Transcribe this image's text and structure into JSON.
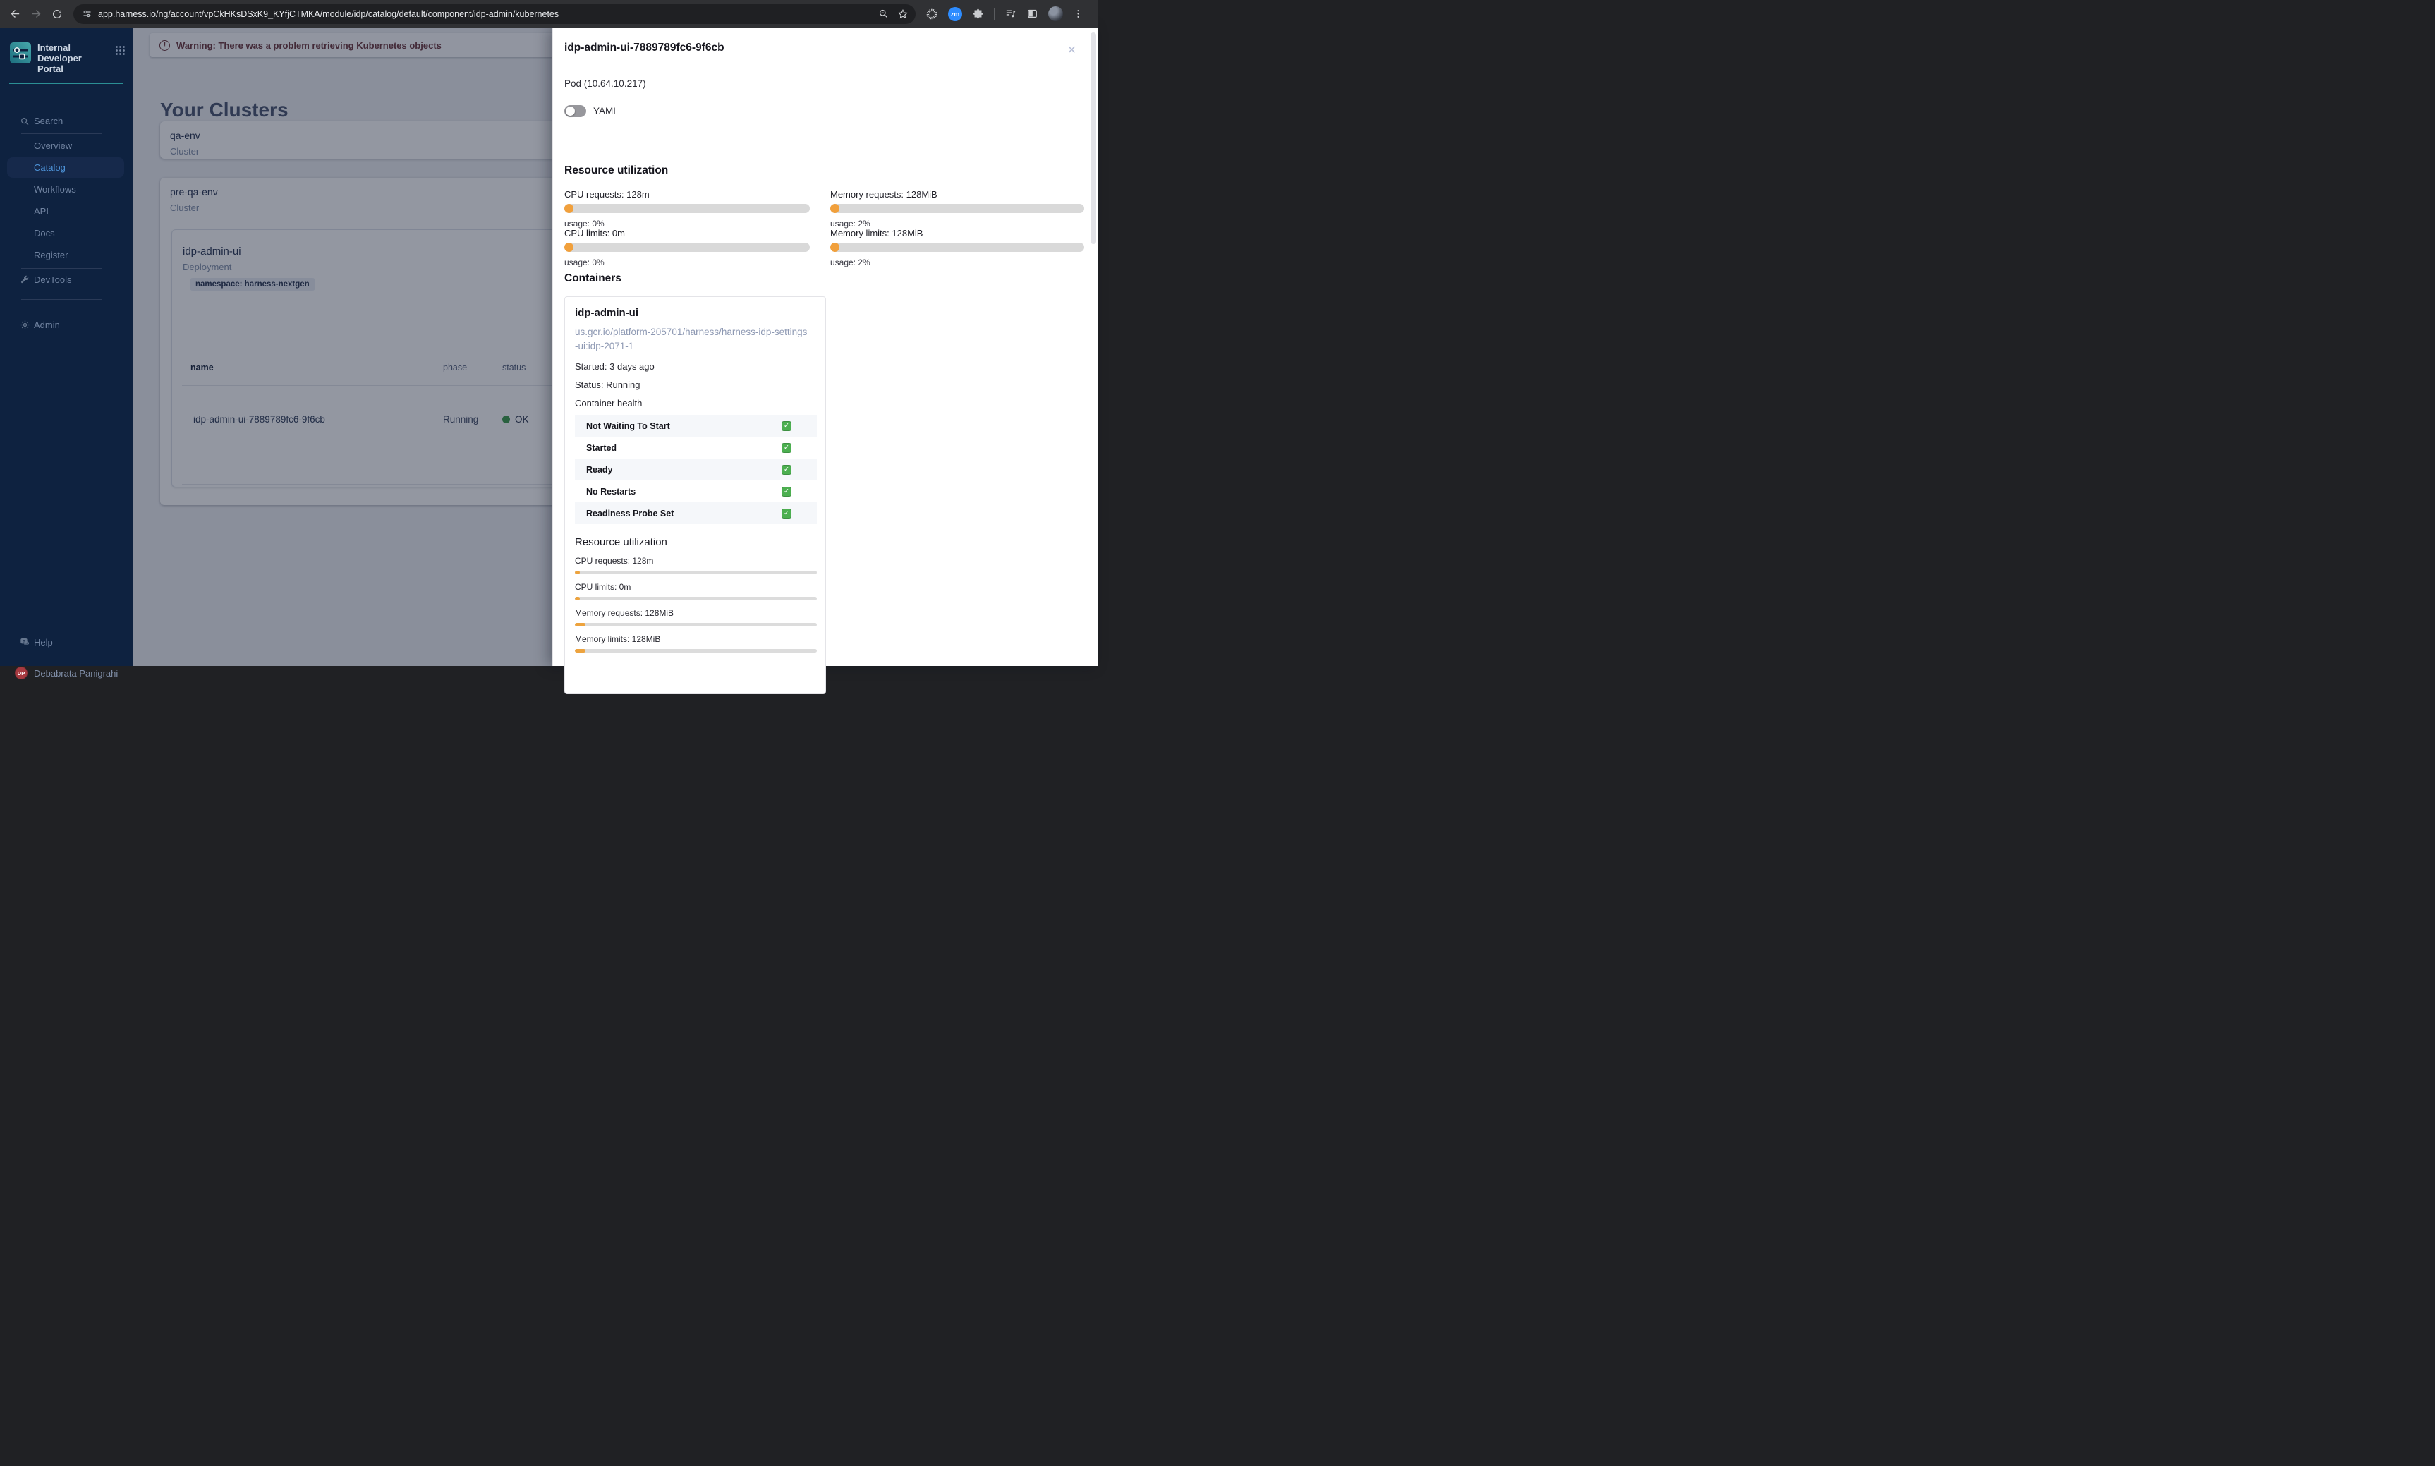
{
  "browser": {
    "url": "app.harness.io/ng/account/vpCkHKsDSxK9_KYfjCTMKA/module/idp/catalog/default/component/idp-admin/kubernetes",
    "zm_badge": "zm"
  },
  "icons": {
    "close": "✕",
    "warning": "!",
    "check": "✓"
  },
  "colors": {
    "accent_orange": "#F1A03C",
    "success_green": "#3F9D4E",
    "sidebar_active_blue": "#4D93D8",
    "sidebar_bg": "#0E2240",
    "warning_text": "#6D3A41"
  },
  "sidebar": {
    "title": "Internal Developer Portal",
    "search_label": "Search",
    "items": [
      {
        "label": "Overview",
        "active": false
      },
      {
        "label": "Catalog",
        "active": true
      },
      {
        "label": "Workflows",
        "active": false
      },
      {
        "label": "API",
        "active": false
      },
      {
        "label": "Docs",
        "active": false
      },
      {
        "label": "Register",
        "active": false
      }
    ],
    "devtools_label": "DevTools",
    "admin_label": "Admin",
    "help_label": "Help",
    "user": {
      "initials": "DP",
      "name": "Debabrata Panigrahi"
    }
  },
  "main": {
    "warning": "Warning: There was a problem retrieving Kubernetes objects",
    "heading": "Your Clusters",
    "clusters": [
      {
        "name": "qa-env",
        "kind": "Cluster"
      },
      {
        "name": "pre-qa-env",
        "kind": "Cluster"
      }
    ],
    "deployment": {
      "name": "idp-admin-ui",
      "kind": "Deployment",
      "namespace": "namespace: harness-nextgen",
      "table": {
        "headers": [
          "name",
          "phase",
          "status"
        ],
        "rows": [
          {
            "name": "idp-admin-ui-7889789fc6-9f6cb",
            "phase": "Running",
            "status": "OK"
          }
        ]
      }
    }
  },
  "drawer": {
    "title": "idp-admin-ui-7889789fc6-9f6cb",
    "subtitle": "Pod (10.64.10.217)",
    "yaml_label": "YAML",
    "resource_utilization": {
      "title": "Resource utilization",
      "items": [
        {
          "label": "CPU requests: 128m",
          "usage": "usage: 0%",
          "pct": 3.7
        },
        {
          "label": "CPU limits: 0m",
          "usage": "usage: 0%",
          "pct": 3.7
        },
        {
          "label": "Memory requests: 128MiB",
          "usage": "usage: 2%",
          "pct": 3.6
        },
        {
          "label": "Memory limits: 128MiB",
          "usage": "usage: 2%",
          "pct": 3.6
        }
      ]
    },
    "containers": {
      "title": "Containers",
      "card": {
        "name": "idp-admin-ui",
        "image": "us.gcr.io/platform-205701/harness/harness-idp-settings-ui:idp-2071-1",
        "started": "Started: 3 days ago",
        "status": "Status: Running",
        "health_title": "Container health",
        "health": [
          {
            "label": "Not Waiting To Start",
            "checked": true
          },
          {
            "label": "Started",
            "checked": true
          },
          {
            "label": "Ready",
            "checked": true
          },
          {
            "label": "No Restarts",
            "checked": true
          },
          {
            "label": "Readiness Probe Set",
            "checked": true
          }
        ],
        "resource_title": "Resource utilization",
        "bars": [
          {
            "label": "CPU requests: 128m",
            "pct": 2.0
          },
          {
            "label": "CPU limits: 0m",
            "pct": 2.0
          },
          {
            "label": "Memory requests: 128MiB",
            "pct": 4.4
          },
          {
            "label": "Memory limits: 128MiB",
            "pct": 4.4
          }
        ]
      }
    }
  }
}
